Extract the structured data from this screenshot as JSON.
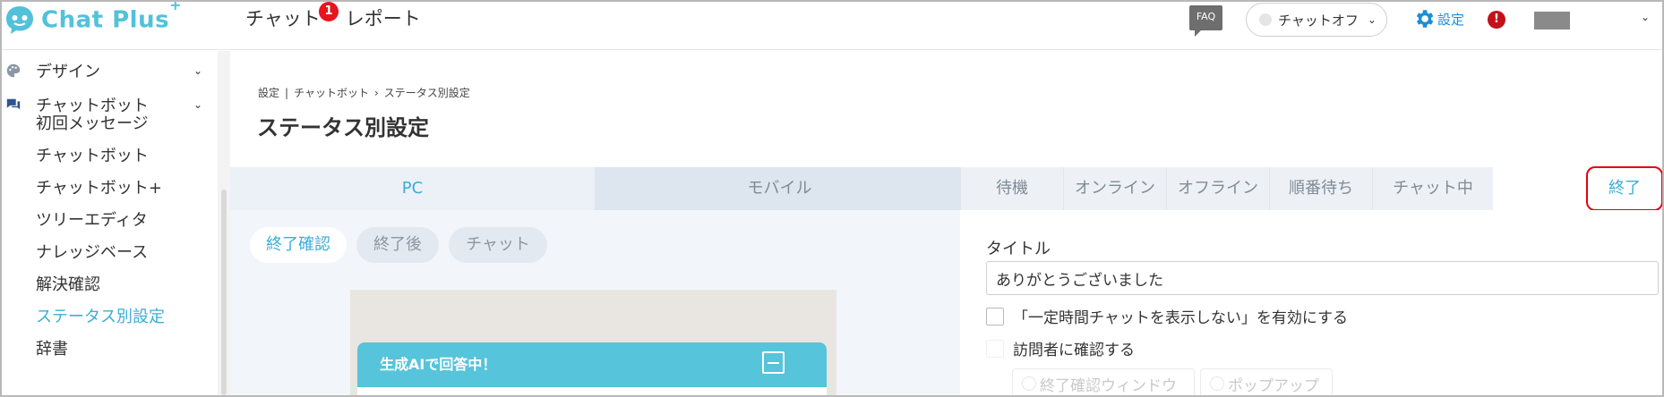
{
  "header": {
    "logo_text": "Chat Plus",
    "logo_sup": "+",
    "nav": [
      {
        "label": "チャット",
        "badge": "1"
      },
      {
        "label": "レポート"
      }
    ],
    "faq": "FAQ",
    "chat_status": "チャットオフ",
    "settings": "設定",
    "alert": "!"
  },
  "sidebar": {
    "groups": [
      {
        "label": "デザイン",
        "icon": "palette-icon"
      },
      {
        "label": "チャットボット",
        "icon": "chat-bubbles-icon"
      }
    ],
    "items": [
      "初回メッセージ",
      "チャットボット",
      "チャットボット+",
      "ツリーエディタ",
      "ナレッジベース",
      "解決確認",
      "ステータス別設定",
      "辞書"
    ],
    "active_item": "ステータス別設定"
  },
  "breadcrumb": {
    "settings": "設定",
    "separator": "|",
    "chatbot": "チャットボット",
    "arrow": "›",
    "current": "ステータス別設定"
  },
  "page_title": "ステータス別設定",
  "device_tabs": {
    "pc": "PC",
    "mobile": "モバイル"
  },
  "status_tabs": [
    "待機",
    "オンライン",
    "オフライン",
    "順番待ち",
    "チャット中"
  ],
  "active_status_tab": "終了",
  "sub_tabs": [
    "終了確認",
    "終了後",
    "チャット"
  ],
  "preview": {
    "widget_title": "生成AIで回答中！"
  },
  "form": {
    "title_label": "タイトル",
    "title_value": "ありがとうございました",
    "checkbox_1": "「一定時間チャットを表示しない」を有効にする",
    "checkbox_2": "訪問者に確認する",
    "radio_1": "終了確認ウィンドウ",
    "radio_2": "ポップアップ"
  },
  "colors": {
    "brand": "#52c2d9",
    "active": "#3aaed5",
    "badge": "#e8141e",
    "highlight": "#e50012",
    "settings": "#1a8fd6"
  }
}
